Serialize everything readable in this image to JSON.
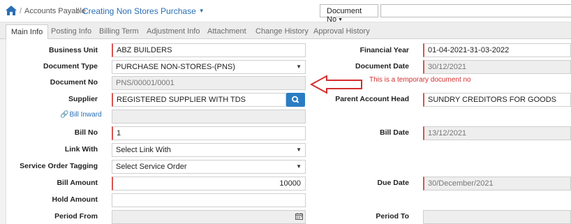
{
  "breadcrumb": {
    "section": "Accounts Payable",
    "page": "Creating Non Stores Purchase"
  },
  "toolbar": {
    "doc_selector": "Document No"
  },
  "tabs": [
    {
      "label": "Main Info",
      "active": true
    },
    {
      "label": "Posting Info"
    },
    {
      "label": "Billing Term"
    },
    {
      "label": "Adjustment Info"
    },
    {
      "label": "Attachment"
    },
    {
      "label": "Change History"
    },
    {
      "label": "Approval History"
    }
  ],
  "form": {
    "business_unit": {
      "label": "Business Unit",
      "value": "ABZ BUILDERS"
    },
    "document_type": {
      "label": "Document Type",
      "value": "PURCHASE NON-STORES-(PNS)"
    },
    "document_no": {
      "label": "Document No",
      "placeholder": "PNS/00001/0001"
    },
    "supplier": {
      "label": "Supplier",
      "value": "REGISTERED SUPPLIER WITH TDS"
    },
    "bill_inward": {
      "label": "Bill Inward"
    },
    "bill_no": {
      "label": "Bill No",
      "value": "1"
    },
    "link_with": {
      "label": "Link With",
      "value": "Select Link With"
    },
    "service_order_tagging": {
      "label": "Service Order Tagging",
      "value": "Select Service Order"
    },
    "bill_amount": {
      "label": "Bill Amount",
      "value": "10000"
    },
    "hold_amount": {
      "label": "Hold Amount",
      "value": ""
    },
    "period_from": {
      "label": "Period From",
      "value": ""
    },
    "financial_year": {
      "label": "Financial Year",
      "value": "01-04-2021-31-03-2022"
    },
    "document_date": {
      "label": "Document Date",
      "value": "30/12/2021"
    },
    "parent_account_head": {
      "label": "Parent Account Head",
      "value": "SUNDRY CREDITORS FOR GOODS"
    },
    "bill_date": {
      "label": "Bill Date",
      "value": "13/12/2021"
    },
    "due_date": {
      "label": "Due Date",
      "value": "30/December/2021"
    },
    "period_to": {
      "label": "Period To",
      "value": ""
    }
  },
  "annotation": {
    "note": "This is a temporary document no",
    "color": "#d32f2f"
  },
  "colors": {
    "accent": "#2a6fb5",
    "required": "#d9534f",
    "button": "#2a7dc4"
  }
}
